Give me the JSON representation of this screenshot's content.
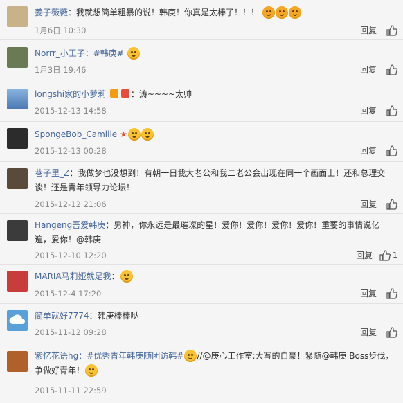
{
  "comments": [
    {
      "user": "姜子薇薇",
      "text": "：我就想简单粗暴的说！韩庚！你真是太棒了！！！",
      "time": "1月6日 10:30",
      "reply": "回复",
      "avatar_color": "#c9b28a"
    },
    {
      "user": "Norrr_小王子",
      "text": "：#韩庚#",
      "time": "1月3日 19:46",
      "reply": "回复",
      "avatar_color": "#6a7a55"
    },
    {
      "user": "longshi家的小萝莉",
      "text": "：涛~~~~太帅",
      "time": "2015-12-13 14:58",
      "reply": "回复",
      "avatar_color": "#4a78b0"
    },
    {
      "user": "SpongeBob_Camille",
      "text": "",
      "time": "2015-12-13 00:28",
      "reply": "回复",
      "avatar_color": "#2c2c2c"
    },
    {
      "user": "巷子里_Z",
      "text": "：我做梦也没想到！有朝一日我大老公和我二老公会出现在同一个画面上！还和总理交谈！还是青年领导力论坛！",
      "time": "2015-12-12 21:06",
      "reply": "回复",
      "avatar_color": "#5a4a3a"
    },
    {
      "user": "Hangeng吾爱韩庚",
      "text": "：男神，你永远是最璀璨的星！爱你！爱你！爱你！爱你！重要的事情说亿遍，爱你！@韩庚",
      "time": "2015-12-10 12:20",
      "reply": "回复",
      "likes": "1",
      "avatar_color": "#3b3b3b"
    },
    {
      "user": "MARIA马莉娅就是我",
      "text": "：",
      "time": "2015-12-4 17:20",
      "reply": "回复",
      "avatar_color": "#c83c3c"
    },
    {
      "user": "简单就好7774",
      "text": "：韩庚棒棒哒",
      "time": "2015-11-12 09:28",
      "reply": "回复",
      "avatar_color": "#5aa0d8"
    },
    {
      "user": "紫忆花语hg",
      "text_a": "：#优秀青年韩庚随团访韩#",
      "text_b": "//@庚心工作室:大写的自豪！紧随@韩庚 Boss步伐，争做好青年！",
      "time": "2015-11-11 22:59",
      "reply": "回复",
      "avatar_color": "#b0602a"
    }
  ],
  "icons": {
    "like": "thumbs-up-icon",
    "emoji": "smiley-emoji-icon"
  }
}
